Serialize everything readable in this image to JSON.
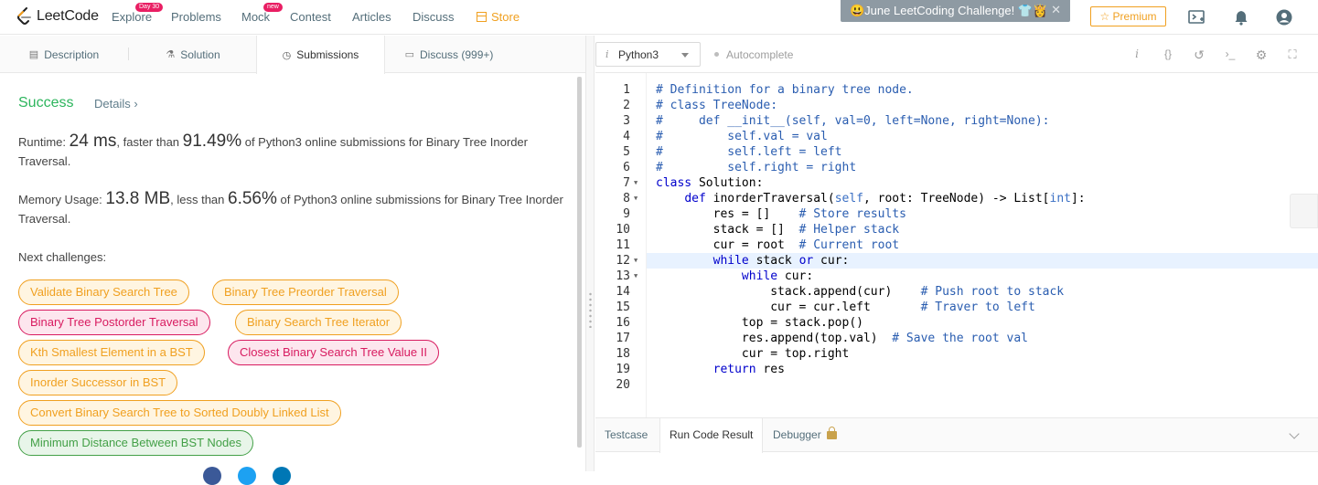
{
  "nav": {
    "logo_text": "LeetCode",
    "links": [
      {
        "label": "Explore",
        "badge": "Day 30"
      },
      {
        "label": "Problems",
        "badge": ""
      },
      {
        "label": "Mock",
        "badge": "new"
      },
      {
        "label": "Contest",
        "badge": ""
      },
      {
        "label": "Articles",
        "badge": ""
      },
      {
        "label": "Discuss",
        "badge": ""
      }
    ],
    "store_label": "Store",
    "toast_text": "😃June LeetCoding Challenge! 👕👸",
    "premium_label": "☆ Premium"
  },
  "left_tabs": {
    "description": "Description",
    "solution": "Solution",
    "submissions": "Submissions",
    "discuss": "Discuss (999+)"
  },
  "result": {
    "status": "Success",
    "details_label": "Details ›",
    "runtime_prefix": "Runtime: ",
    "runtime_value": "24 ms",
    "runtime_mid": ", faster than ",
    "runtime_pct": "91.49%",
    "runtime_suffix": " of Python3 online submissions for Binary Tree Inorder Traversal.",
    "memory_prefix": "Memory Usage: ",
    "memory_value": "13.8 MB",
    "memory_mid": ", less than ",
    "memory_pct": "6.56%",
    "memory_suffix": " of Python3 online submissions for Binary Tree Inorder Traversal."
  },
  "next_challenges": {
    "label": "Next challenges:",
    "items": [
      {
        "label": "Validate Binary Search Tree",
        "difficulty": "medium"
      },
      {
        "label": "Binary Tree Preorder Traversal",
        "difficulty": "medium"
      },
      {
        "label": "Binary Tree Postorder Traversal",
        "difficulty": "hard"
      },
      {
        "label": "Binary Search Tree Iterator",
        "difficulty": "medium"
      },
      {
        "label": "Kth Smallest Element in a BST",
        "difficulty": "medium"
      },
      {
        "label": "Closest Binary Search Tree Value II",
        "difficulty": "hard"
      },
      {
        "label": "Inorder Successor in BST",
        "difficulty": "medium"
      },
      {
        "label": "Convert Binary Search Tree to Sorted Doubly Linked List",
        "difficulty": "medium"
      },
      {
        "label": "Minimum Distance Between BST Nodes",
        "difficulty": "easy"
      }
    ]
  },
  "editor": {
    "language": "Python3",
    "autocomplete_label": "Autocomplete",
    "highlighted_line": 12,
    "folds": [
      7,
      8,
      12,
      13
    ],
    "lines": [
      [
        [
          "c-com",
          "# Definition for a binary tree node."
        ]
      ],
      [
        [
          "c-com",
          "# class TreeNode:"
        ]
      ],
      [
        [
          "c-com",
          "#     def __init__(self, val=0, left=None, right=None):"
        ]
      ],
      [
        [
          "c-com",
          "#         self.val = val"
        ]
      ],
      [
        [
          "c-com",
          "#         self.left = left"
        ]
      ],
      [
        [
          "c-com",
          "#         self.right = right"
        ]
      ],
      [
        [
          "c-kw",
          "class"
        ],
        [
          "",
          " Solution:"
        ]
      ],
      [
        [
          "",
          "    "
        ],
        [
          "c-kw",
          "def"
        ],
        [
          "",
          " inorderTraversal("
        ],
        [
          "c-bi",
          "self"
        ],
        [
          "",
          ", root: TreeNode) -> List["
        ],
        [
          "c-bi",
          "int"
        ],
        [
          "",
          "]:"
        ]
      ],
      [
        [
          "",
          "        res = []    "
        ],
        [
          "c-com",
          "# Store results"
        ]
      ],
      [
        [
          "",
          "        stack = []  "
        ],
        [
          "c-com",
          "# Helper stack"
        ]
      ],
      [
        [
          "",
          "        cur = root  "
        ],
        [
          "c-com",
          "# Current root"
        ]
      ],
      [
        [
          "",
          "        "
        ],
        [
          "c-kw",
          "while"
        ],
        [
          "",
          " stack "
        ],
        [
          "c-kw",
          "or"
        ],
        [
          "",
          " cur:"
        ]
      ],
      [
        [
          "",
          "            "
        ],
        [
          "c-kw",
          "while"
        ],
        [
          "",
          " cur:"
        ]
      ],
      [
        [
          "",
          "                stack.append(cur)    "
        ],
        [
          "c-com",
          "# Push root to stack"
        ]
      ],
      [
        [
          "",
          "                cur = cur.left       "
        ],
        [
          "c-com",
          "# Traver to left"
        ]
      ],
      [
        [
          "",
          "            top = stack.pop()"
        ]
      ],
      [
        [
          "",
          "            res.append(top.val)  "
        ],
        [
          "c-com",
          "# Save the root val"
        ]
      ],
      [
        [
          "",
          "            cur = top.right"
        ]
      ],
      [
        [
          "",
          "        "
        ],
        [
          "c-kw",
          "return"
        ],
        [
          "",
          " res"
        ]
      ],
      [
        [
          "",
          ""
        ]
      ]
    ]
  },
  "console": {
    "tabs": [
      "Testcase",
      "Run Code Result",
      "Debugger"
    ]
  },
  "colors": {
    "success": "#2db55d",
    "medium": "#f0a020",
    "hard": "#d81b60",
    "easy": "#43a047"
  }
}
